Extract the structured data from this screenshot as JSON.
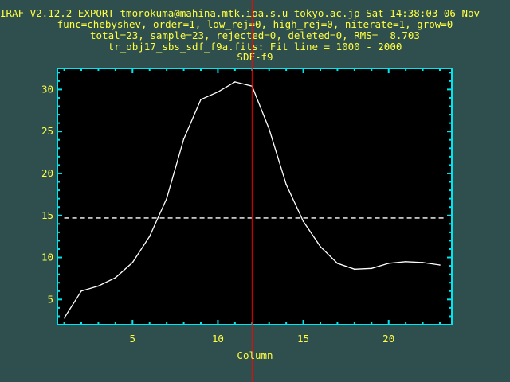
{
  "header": {
    "line1": "IRAF V2.12.2-EXPORT tmorokuma@mahina.mtk.ioa.s.u-tokyo.ac.jp Sat 14:38:03 06-Nov",
    "line2": "func=chebyshev, order=1, low_rej=0, high_rej=0, niterate=1, grow=0",
    "line3": "total=23, sample=23, rejected=0, deleted=0, RMS=  8.703",
    "line4": "tr_obj17_sbs_sdf_f9a.fits: Fit line = 1000 - 2000",
    "line5": "SDF-f9"
  },
  "colors": {
    "background": "#2f4f4f",
    "plot_bg": "#000000",
    "axis": "#00e5ee",
    "text": "#ffff40",
    "data_line": "#ffffff",
    "fit_line": "#ffffff",
    "cursor": "#ff0000"
  },
  "chart_data": {
    "type": "line",
    "title": "SDF-f9",
    "xlabel": "Column",
    "ylabel": "",
    "xlim": [
      0.6,
      23.7
    ],
    "ylim": [
      2.0,
      32.5
    ],
    "xticks": [
      5,
      10,
      15,
      20
    ],
    "yticks": [
      5,
      10,
      15,
      20,
      25,
      30
    ],
    "x": [
      1,
      2,
      3,
      4,
      5,
      6,
      7,
      8,
      9,
      10,
      11,
      12,
      13,
      14,
      15,
      16,
      17,
      18,
      19,
      20,
      21,
      22,
      23
    ],
    "series": [
      {
        "values": [
          2.8,
          6.0,
          6.6,
          7.6,
          9.4,
          12.5,
          17.0,
          24.1,
          28.8,
          29.7,
          30.9,
          30.4,
          25.3,
          18.7,
          14.3,
          11.3,
          9.3,
          8.6,
          8.7,
          9.3,
          9.5,
          9.4,
          9.1
        ]
      }
    ],
    "fit": {
      "x": [
        1,
        23.3
      ],
      "y": [
        14.7,
        14.7
      ]
    },
    "cursor_x": 12.0,
    "grid": false
  }
}
